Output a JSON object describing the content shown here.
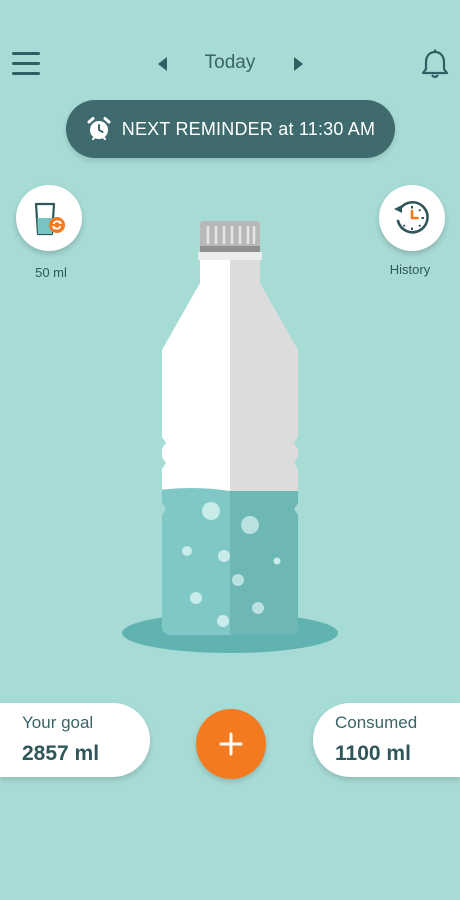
{
  "header": {
    "date_label": "Today",
    "menu_icon": "hamburger-icon",
    "prev_icon": "chevron-left-icon",
    "next_icon": "chevron-right-icon",
    "bell_icon": "bell-icon"
  },
  "reminder": {
    "text": "NEXT REMINDER at 11:30 AM",
    "icon": "alarm-clock-icon"
  },
  "cup": {
    "label": "50 ml",
    "icon": "glass-refresh-icon"
  },
  "history": {
    "label": "History",
    "icon": "history-clock-icon"
  },
  "goal": {
    "title": "Your goal",
    "value": "2857 ml"
  },
  "consumed": {
    "title": "Consumed",
    "value": "1100 ml"
  },
  "add_button": {
    "icon": "plus-icon"
  },
  "colors": {
    "background": "#a7dbd6",
    "accent": "#f47a1f",
    "dark_teal": "#3f6b6e",
    "water": "#77c4c2"
  }
}
